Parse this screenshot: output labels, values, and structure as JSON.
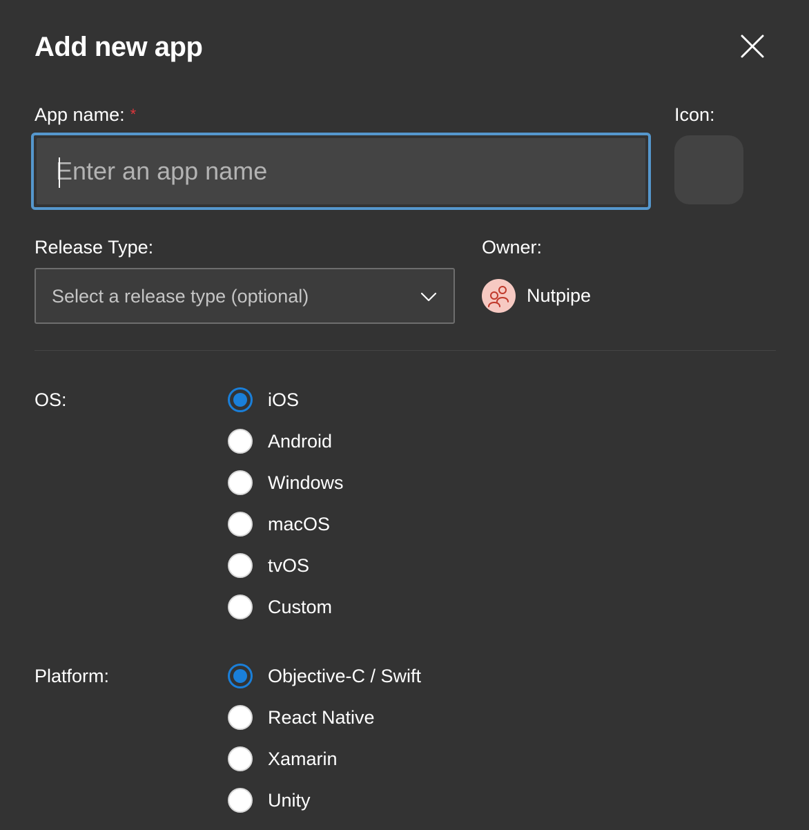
{
  "dialog": {
    "title": "Add new app"
  },
  "app_name": {
    "label": "App name:",
    "required_mark": "*",
    "value": "",
    "placeholder": "Enter an app name"
  },
  "icon": {
    "label": "Icon:"
  },
  "release_type": {
    "label": "Release Type:",
    "selected": "Select a release type (optional)"
  },
  "owner": {
    "label": "Owner:",
    "name": "Nutpipe"
  },
  "os": {
    "label": "OS:",
    "options": [
      {
        "label": "iOS",
        "checked": true
      },
      {
        "label": "Android",
        "checked": false
      },
      {
        "label": "Windows",
        "checked": false
      },
      {
        "label": "macOS",
        "checked": false
      },
      {
        "label": "tvOS",
        "checked": false
      },
      {
        "label": "Custom",
        "checked": false
      }
    ]
  },
  "platform": {
    "label": "Platform:",
    "options": [
      {
        "label": "Objective-C / Swift",
        "checked": true
      },
      {
        "label": "React Native",
        "checked": false
      },
      {
        "label": "Xamarin",
        "checked": false
      },
      {
        "label": "Unity",
        "checked": false
      }
    ]
  },
  "colors": {
    "background": "#333333",
    "focus_border": "#5597cd",
    "accent": "#1a7fd9",
    "required": "#e0363c",
    "avatar_bg": "#f6c9c2",
    "avatar_fg": "#c0392b"
  }
}
